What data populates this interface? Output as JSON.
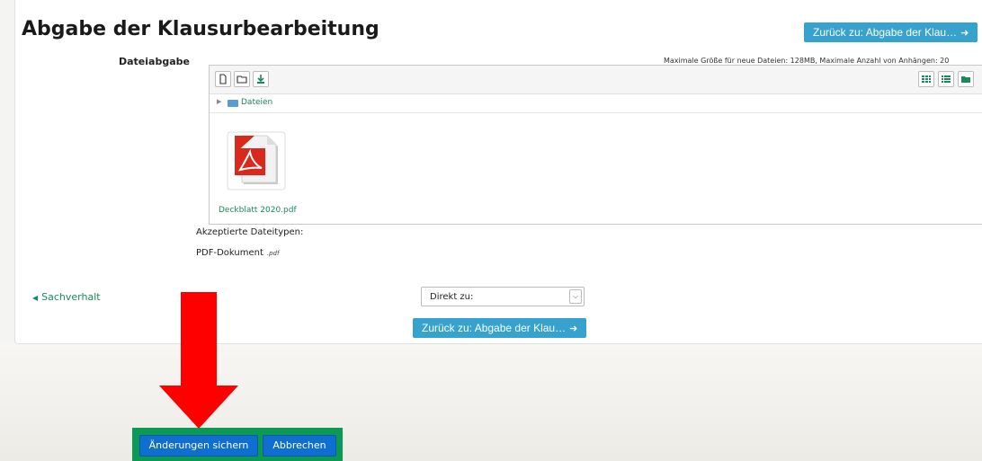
{
  "page": {
    "title": "Abgabe der Klausurbearbeitung",
    "back_button_label": "Zurück zu: Abgabe der Klau…",
    "back_button_icon": "sign-in-icon"
  },
  "file_submission": {
    "label": "Dateiabgabe",
    "max_info": "Maximale Größe für neue Dateien: 128MB, Maximale Anzahl von Anhängen: 20",
    "toolbar_left_icons": [
      "add-file-icon",
      "create-folder-icon",
      "download-icon"
    ],
    "toolbar_right_icons": [
      "grid-view-icon",
      "list-view-icon",
      "tree-view-icon"
    ],
    "path_root": "Dateien",
    "files": [
      {
        "name": "Deckblatt 2020.pdf",
        "icon": "pdf-file-icon"
      }
    ],
    "accepted_types_heading": "Akzeptierte Dateitypen:",
    "accepted_type_name": "PDF-Dokument",
    "accepted_type_ext": ".pdf"
  },
  "navigation": {
    "prev_link": "Sachverhalt",
    "jump_select_value": "Direkt zu:",
    "back_button_label": "Zurück zu: Abgabe der Klau…"
  },
  "actions": {
    "save_label": "Änderungen sichern",
    "cancel_label": "Abbrechen"
  },
  "colors": {
    "info_button": "#36a2cd",
    "primary_button": "#0e6fd0",
    "highlight_box": "#0b9a55",
    "link_green": "#1a8a5c",
    "annotation_arrow": "#ff0000"
  }
}
